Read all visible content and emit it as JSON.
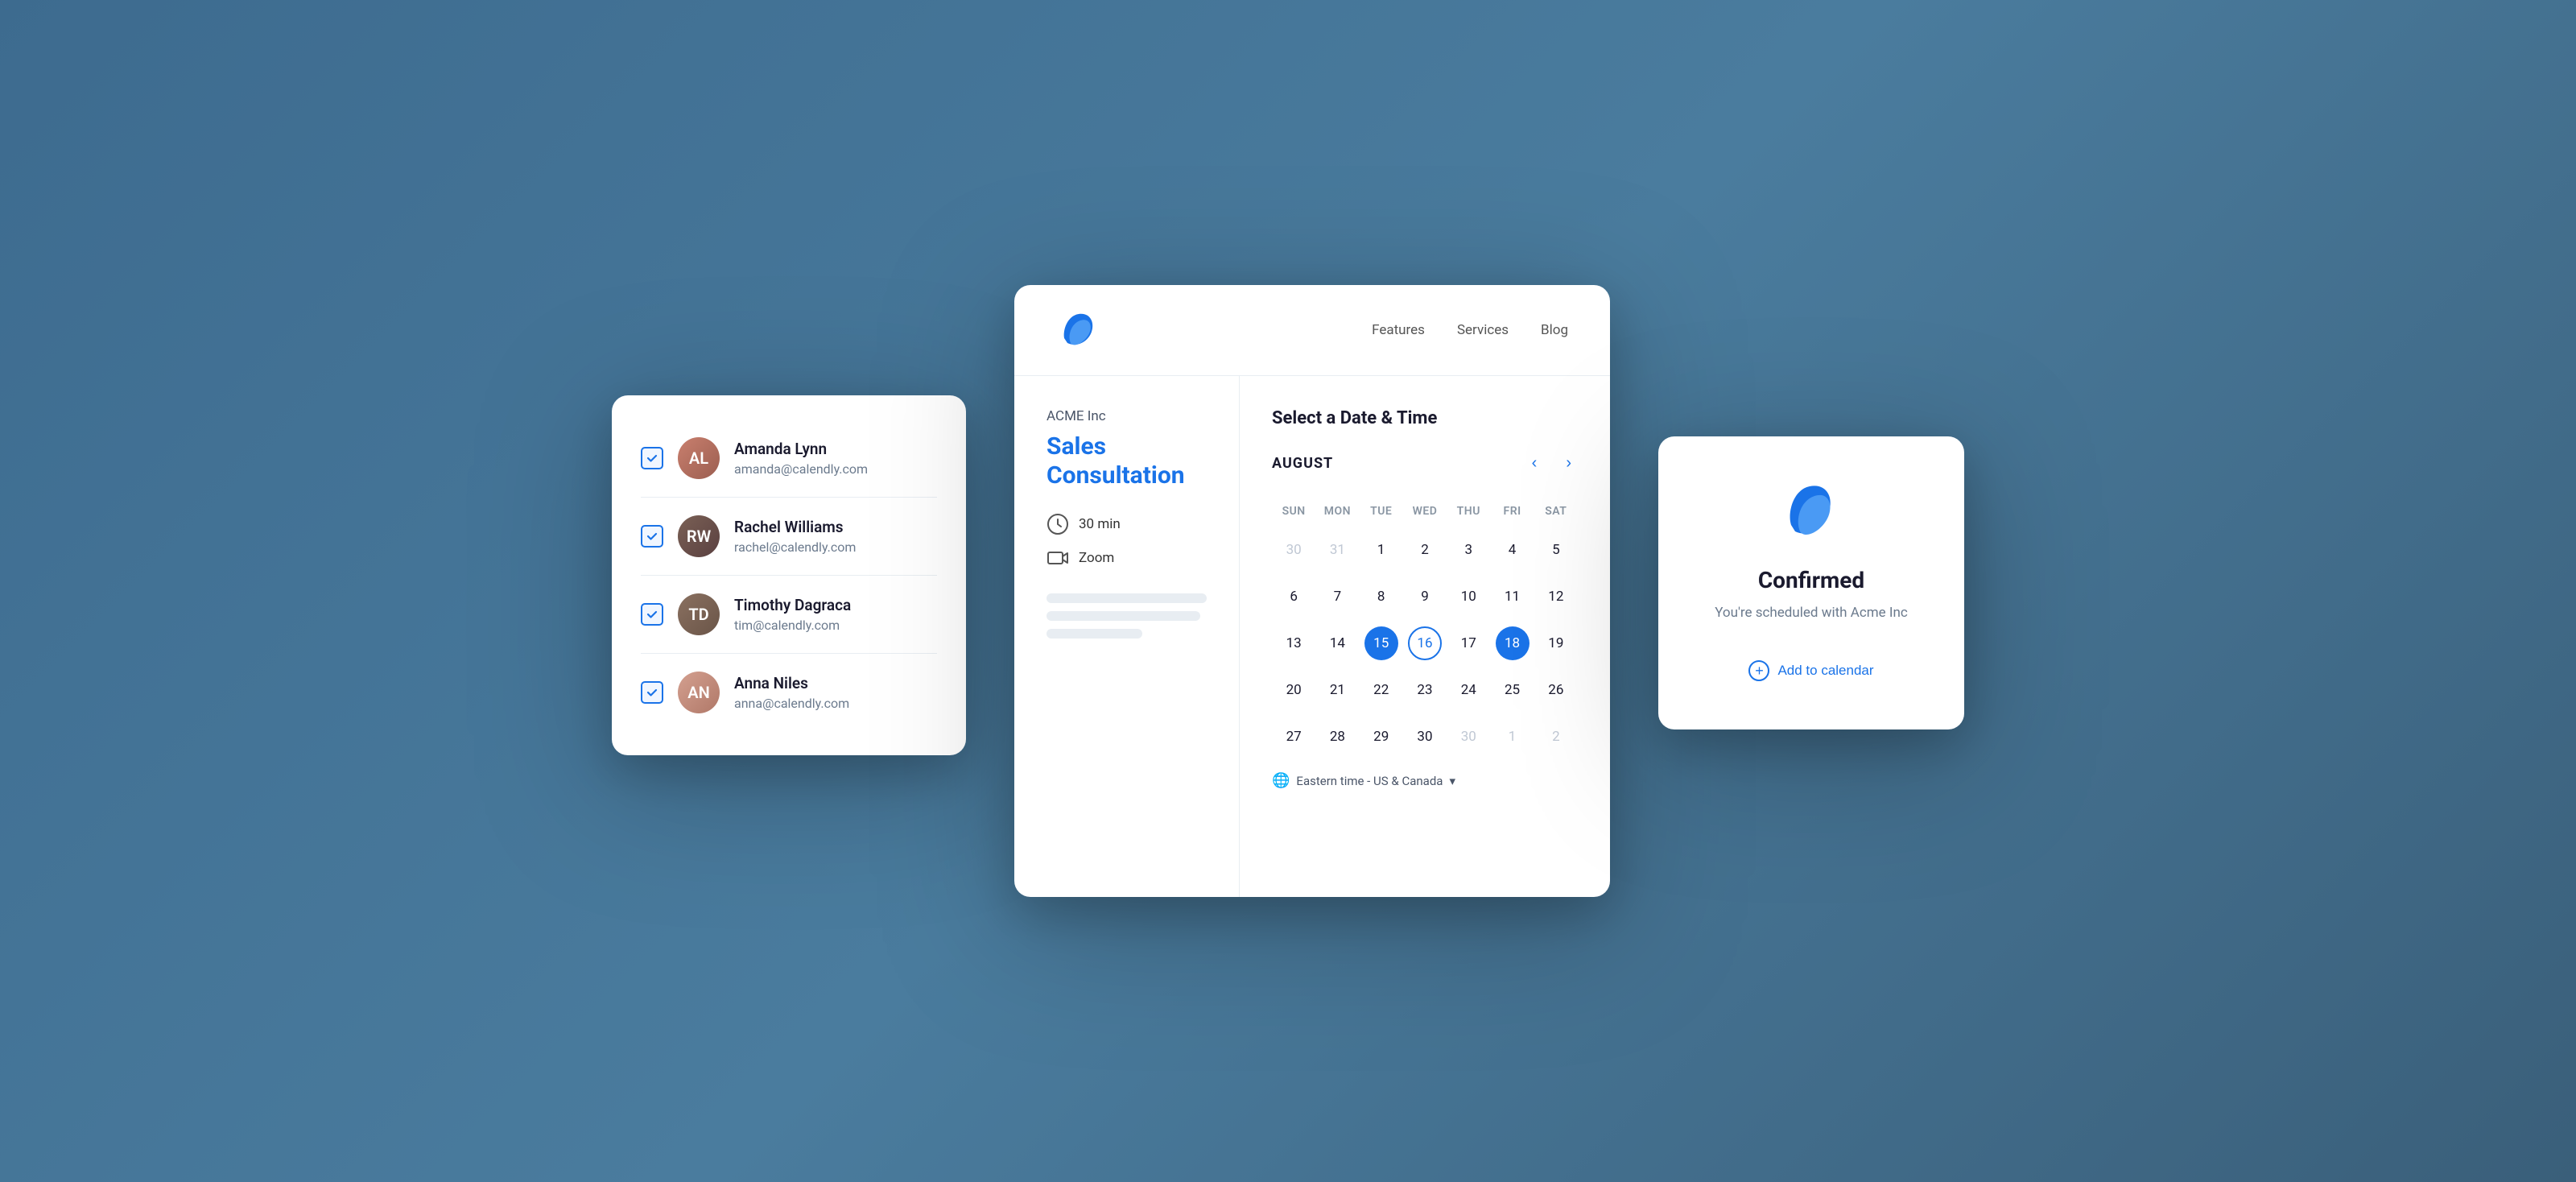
{
  "nav": {
    "features_label": "Features",
    "services_label": "Services",
    "blog_label": "Blog"
  },
  "user_list": {
    "users": [
      {
        "name": "Amanda Lynn",
        "email": "amanda@calendly.com",
        "initials": "AL"
      },
      {
        "name": "Rachel Williams",
        "email": "rachel@calendly.com",
        "initials": "RW"
      },
      {
        "name": "Timothy Dagraca",
        "email": "tim@calendly.com",
        "initials": "TD"
      },
      {
        "name": "Anna Niles",
        "email": "anna@calendly.com",
        "initials": "AN"
      }
    ]
  },
  "booking": {
    "company": "ACME Inc",
    "title": "Sales Consultation",
    "duration": "30 min",
    "platform": "Zoom",
    "select_date_time": "Select a Date & Time",
    "month": "AUGUST",
    "timezone": "Eastern time - US & Canada",
    "day_headers": [
      "SUN",
      "MON",
      "TUE",
      "WED",
      "THU",
      "FRI",
      "SAT"
    ],
    "weeks": [
      [
        {
          "day": "30",
          "type": "inactive"
        },
        {
          "day": "31",
          "type": "inactive"
        },
        {
          "day": "1",
          "type": "available"
        },
        {
          "day": "2",
          "type": "available"
        },
        {
          "day": "3",
          "type": "available"
        },
        {
          "day": "4",
          "type": "available"
        },
        {
          "day": "5",
          "type": "available"
        }
      ],
      [
        {
          "day": "6",
          "type": "available"
        },
        {
          "day": "7",
          "type": "available"
        },
        {
          "day": "8",
          "type": "available"
        },
        {
          "day": "9",
          "type": "available"
        },
        {
          "day": "10",
          "type": "available"
        },
        {
          "day": "11",
          "type": "available"
        },
        {
          "day": "12",
          "type": "available"
        }
      ],
      [
        {
          "day": "13",
          "type": "available"
        },
        {
          "day": "14",
          "type": "available"
        },
        {
          "day": "15",
          "type": "selected-blue"
        },
        {
          "day": "16",
          "type": "selected-outline"
        },
        {
          "day": "17",
          "type": "available"
        },
        {
          "day": "18",
          "type": "selected-blue"
        },
        {
          "day": "19",
          "type": "available"
        }
      ],
      [
        {
          "day": "20",
          "type": "available"
        },
        {
          "day": "21",
          "type": "available"
        },
        {
          "day": "22",
          "type": "available"
        },
        {
          "day": "23",
          "type": "available"
        },
        {
          "day": "24",
          "type": "available"
        },
        {
          "day": "25",
          "type": "available"
        },
        {
          "day": "26",
          "type": "available"
        }
      ],
      [
        {
          "day": "27",
          "type": "available"
        },
        {
          "day": "28",
          "type": "available"
        },
        {
          "day": "29",
          "type": "available"
        },
        {
          "day": "30",
          "type": "available"
        },
        {
          "day": "30",
          "type": "inactive"
        },
        {
          "day": "1",
          "type": "inactive"
        },
        {
          "day": "2",
          "type": "inactive"
        }
      ]
    ]
  },
  "confirmation": {
    "title": "Confirmed",
    "subtitle": "You're scheduled with Acme Inc",
    "add_calendar": "Add to calendar"
  }
}
